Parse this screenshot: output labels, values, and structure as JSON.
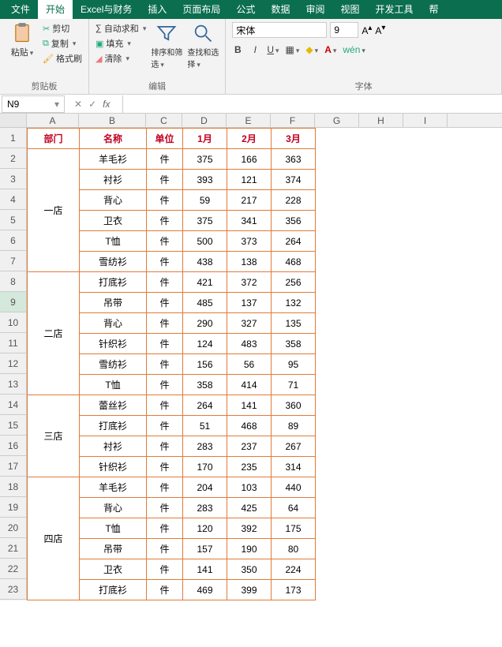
{
  "menu": {
    "file": "文件",
    "start": "开始",
    "excel": "Excel与财务",
    "insert": "插入",
    "layout": "页面布局",
    "formula": "公式",
    "data": "数据",
    "review": "审阅",
    "view": "视图",
    "dev": "开发工具",
    "help": "帮"
  },
  "ribbon": {
    "clipboard": {
      "paste": "粘贴",
      "cut": "剪切",
      "copy": "复制",
      "brush": "格式刷",
      "label": "剪贴板"
    },
    "edit": {
      "sum": "自动求和",
      "fill": "填充",
      "clear": "清除",
      "sort": "排序和筛选",
      "find": "查找和选择",
      "label": "编辑"
    },
    "font": {
      "name": "宋体",
      "size": "9",
      "label": "字体"
    }
  },
  "cellref": "N9",
  "cols": [
    "A",
    "B",
    "C",
    "D",
    "E",
    "F",
    "G",
    "H",
    "I"
  ],
  "headers": {
    "dept": "部门",
    "name": "名称",
    "unit": "单位",
    "m1": "1月",
    "m2": "2月",
    "m3": "3月"
  },
  "sections": [
    {
      "dept": "一店",
      "rows": [
        {
          "n": "羊毛衫",
          "u": "件",
          "v": [
            375,
            166,
            363
          ]
        },
        {
          "n": "衬衫",
          "u": "件",
          "v": [
            393,
            121,
            374
          ]
        },
        {
          "n": "背心",
          "u": "件",
          "v": [
            59,
            217,
            228
          ]
        },
        {
          "n": "卫衣",
          "u": "件",
          "v": [
            375,
            341,
            356
          ]
        },
        {
          "n": "T恤",
          "u": "件",
          "v": [
            500,
            373,
            264
          ]
        },
        {
          "n": "雪纺衫",
          "u": "件",
          "v": [
            438,
            138,
            468
          ]
        }
      ]
    },
    {
      "dept": "二店",
      "rows": [
        {
          "n": "打底衫",
          "u": "件",
          "v": [
            421,
            372,
            256
          ]
        },
        {
          "n": "吊带",
          "u": "件",
          "v": [
            485,
            137,
            132
          ]
        },
        {
          "n": "背心",
          "u": "件",
          "v": [
            290,
            327,
            135
          ]
        },
        {
          "n": "针织衫",
          "u": "件",
          "v": [
            124,
            483,
            358
          ]
        },
        {
          "n": "雪纺衫",
          "u": "件",
          "v": [
            156,
            56,
            95
          ]
        },
        {
          "n": "T恤",
          "u": "件",
          "v": [
            358,
            414,
            71
          ]
        }
      ]
    },
    {
      "dept": "三店",
      "rows": [
        {
          "n": "蕾丝衫",
          "u": "件",
          "v": [
            264,
            141,
            360
          ]
        },
        {
          "n": "打底衫",
          "u": "件",
          "v": [
            51,
            468,
            89
          ]
        },
        {
          "n": "衬衫",
          "u": "件",
          "v": [
            283,
            237,
            267
          ]
        },
        {
          "n": "针织衫",
          "u": "件",
          "v": [
            170,
            235,
            314
          ]
        }
      ]
    },
    {
      "dept": "四店",
      "rows": [
        {
          "n": "羊毛衫",
          "u": "件",
          "v": [
            204,
            103,
            440
          ]
        },
        {
          "n": "背心",
          "u": "件",
          "v": [
            283,
            425,
            64
          ]
        },
        {
          "n": "T恤",
          "u": "件",
          "v": [
            120,
            392,
            175
          ]
        },
        {
          "n": "吊带",
          "u": "件",
          "v": [
            157,
            190,
            80
          ]
        },
        {
          "n": "卫衣",
          "u": "件",
          "v": [
            141,
            350,
            224
          ]
        },
        {
          "n": "打底衫",
          "u": "件",
          "v": [
            469,
            399,
            173
          ]
        }
      ]
    }
  ]
}
